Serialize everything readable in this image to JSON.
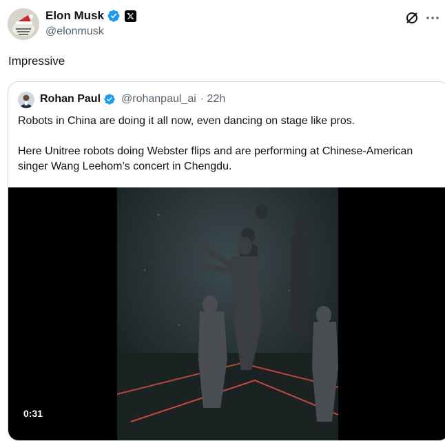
{
  "author": {
    "name": "Elon Musk",
    "handle": "@elonmusk"
  },
  "tweet": {
    "text": "Impressive"
  },
  "quoted": {
    "name": "Rohan Paul",
    "handle": "@rohanpaul_ai",
    "time": "· 22h",
    "paragraphs": [
      "Robots in China are doing it all now, even dancing on stage like pros.",
      "Here Unitree robots doing Webster flips and are performing at Chinese-American singer Wang Leehom’s concert in Chengdu."
    ],
    "video": {
      "duration": "0:31"
    }
  },
  "icons": {
    "verified": "verified-badge-icon",
    "affiliate": "x-logo-icon",
    "grok": "grok-icon",
    "more": "more-icon"
  },
  "colors": {
    "verified": "#1d9bf0",
    "secondary_text": "#536471",
    "border": "#cfd9de"
  }
}
